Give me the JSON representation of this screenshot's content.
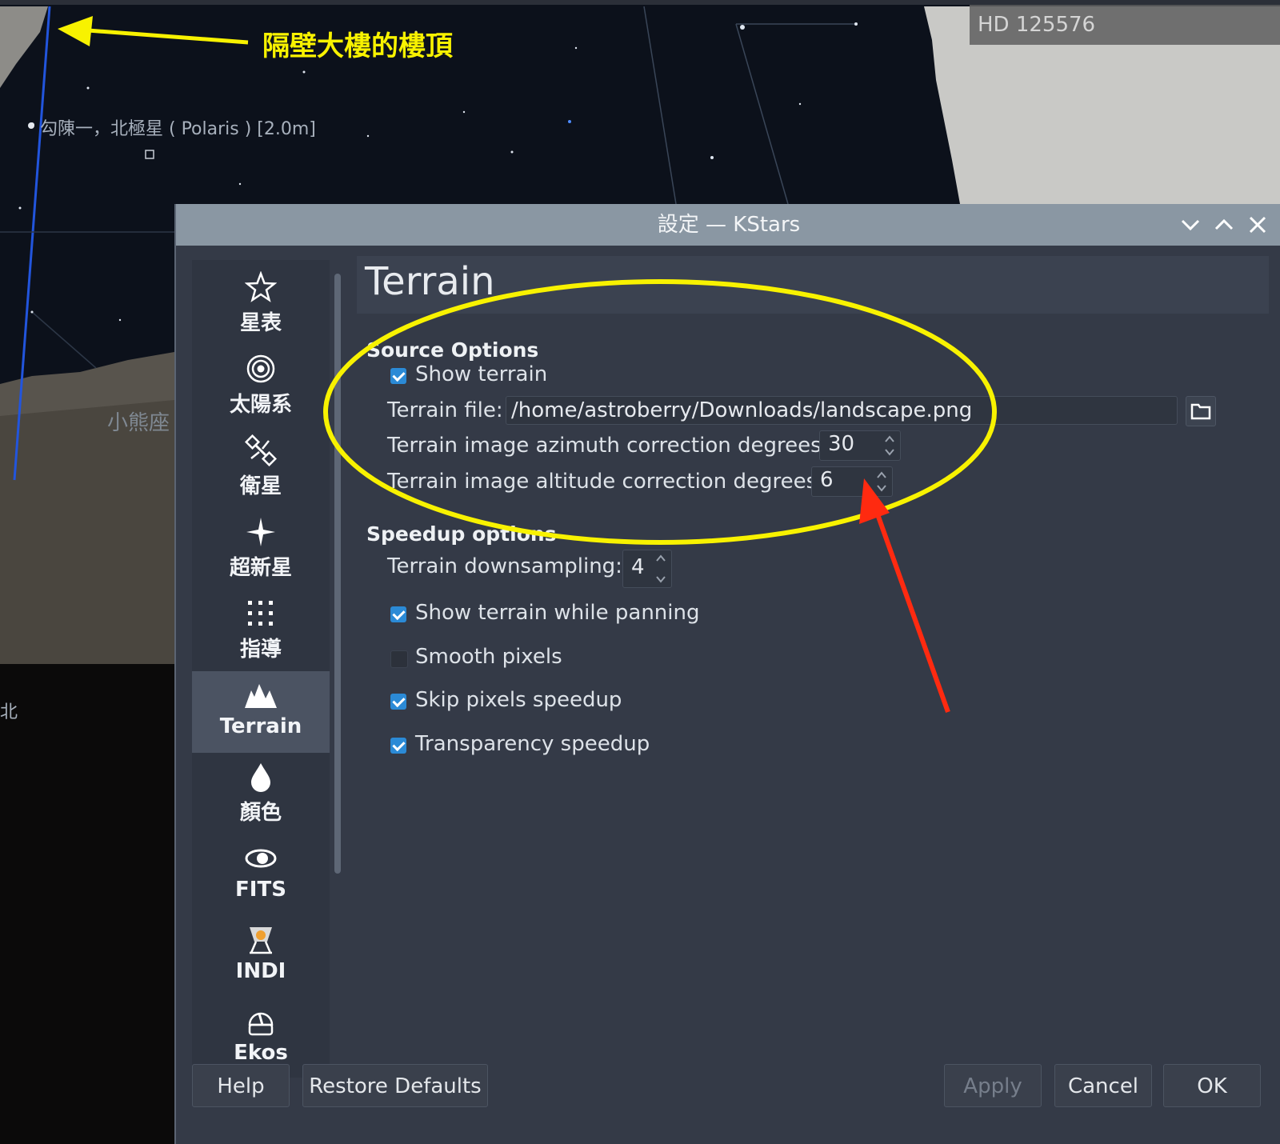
{
  "sky": {
    "star_label": "勾陳一，北極星 ( Polaris ) [2.0m]",
    "constellation_label": "小熊座",
    "direction_label": "北",
    "hovered_object": "HD 125576",
    "annotation_text": "隔壁大樓的樓頂"
  },
  "dialog": {
    "title": "設定 — KStars",
    "window_buttons": [
      "minimize-icon",
      "maximize-icon",
      "close-icon"
    ]
  },
  "sidebar": {
    "items": [
      {
        "label": "星表",
        "icon": "star-icon",
        "active": false
      },
      {
        "label": "太陽系",
        "icon": "solar-system-icon",
        "active": false
      },
      {
        "label": "衛星",
        "icon": "satellite-icon",
        "active": false
      },
      {
        "label": "超新星",
        "icon": "supernova-icon",
        "active": false
      },
      {
        "label": "指導",
        "icon": "guide-dots-icon",
        "active": false
      },
      {
        "label": "Terrain",
        "icon": "mountains-icon",
        "active": true
      },
      {
        "label": "顏色",
        "icon": "color-drop-icon",
        "active": false
      },
      {
        "label": "FITS",
        "icon": "fits-galaxy-icon",
        "active": false
      },
      {
        "label": "INDI",
        "icon": "indi-icon",
        "active": false
      },
      {
        "label": "Ekos",
        "icon": "ekos-dome-icon",
        "active": false
      }
    ]
  },
  "page": {
    "title": "Terrain",
    "source_options": {
      "title": "Source Options",
      "show_terrain": {
        "label": "Show terrain",
        "checked": true
      },
      "terrain_file": {
        "label": "Terrain file:",
        "value": "/home/astroberry/Downloads/landscape.png"
      },
      "azimuth": {
        "label": "Terrain image azimuth correction degrees:",
        "value": "30"
      },
      "altitude": {
        "label": "Terrain image altitude correction degrees:",
        "value": "6"
      }
    },
    "speedup_options": {
      "title": "Speedup options",
      "downsampling": {
        "label": "Terrain downsampling:",
        "value": "4"
      },
      "show_while_panning": {
        "label": "Show terrain while panning",
        "checked": true
      },
      "smooth_pixels": {
        "label": "Smooth pixels",
        "checked": false
      },
      "skip_pixels": {
        "label": "Skip pixels speedup",
        "checked": true
      },
      "transparency": {
        "label": "Transparency speedup",
        "checked": true
      }
    }
  },
  "buttons": {
    "help": "Help",
    "restore_defaults": "Restore Defaults",
    "apply": "Apply",
    "cancel": "Cancel",
    "ok": "OK"
  },
  "colors": {
    "annotation_yellow": "#f8f200",
    "annotation_red": "#ff2a10",
    "checkbox_accent": "#2b8ad6",
    "dialog_bg": "#343a47"
  }
}
